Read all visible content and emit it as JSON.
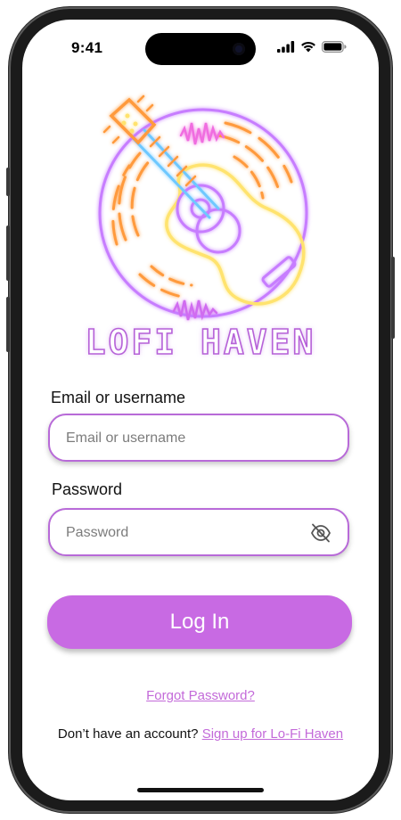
{
  "status_bar": {
    "time": "9:41"
  },
  "brand": {
    "name": "LOFI HAVEN"
  },
  "form": {
    "email_label": "Email or username",
    "email_placeholder": "Email or username",
    "email_value": "",
    "password_label": "Password",
    "password_placeholder": "Password",
    "password_value": "",
    "login_label": "Log In"
  },
  "links": {
    "forgot_password": "Forgot Password?",
    "signup_prompt": "Don’t have an account?",
    "signup_link": "Sign up for Lo-Fi Haven"
  },
  "colors": {
    "accent": "#c86ae3",
    "neon_purple": "#c77dff",
    "neon_orange": "#ff9a3c",
    "neon_yellow": "#ffe36e",
    "neon_blue": "#6ec8ff",
    "neon_pink": "#f06de0"
  },
  "icons": {
    "password_toggle": "eye-off-icon",
    "signal": "cellular-signal-icon",
    "wifi": "wifi-icon",
    "battery": "battery-icon"
  }
}
